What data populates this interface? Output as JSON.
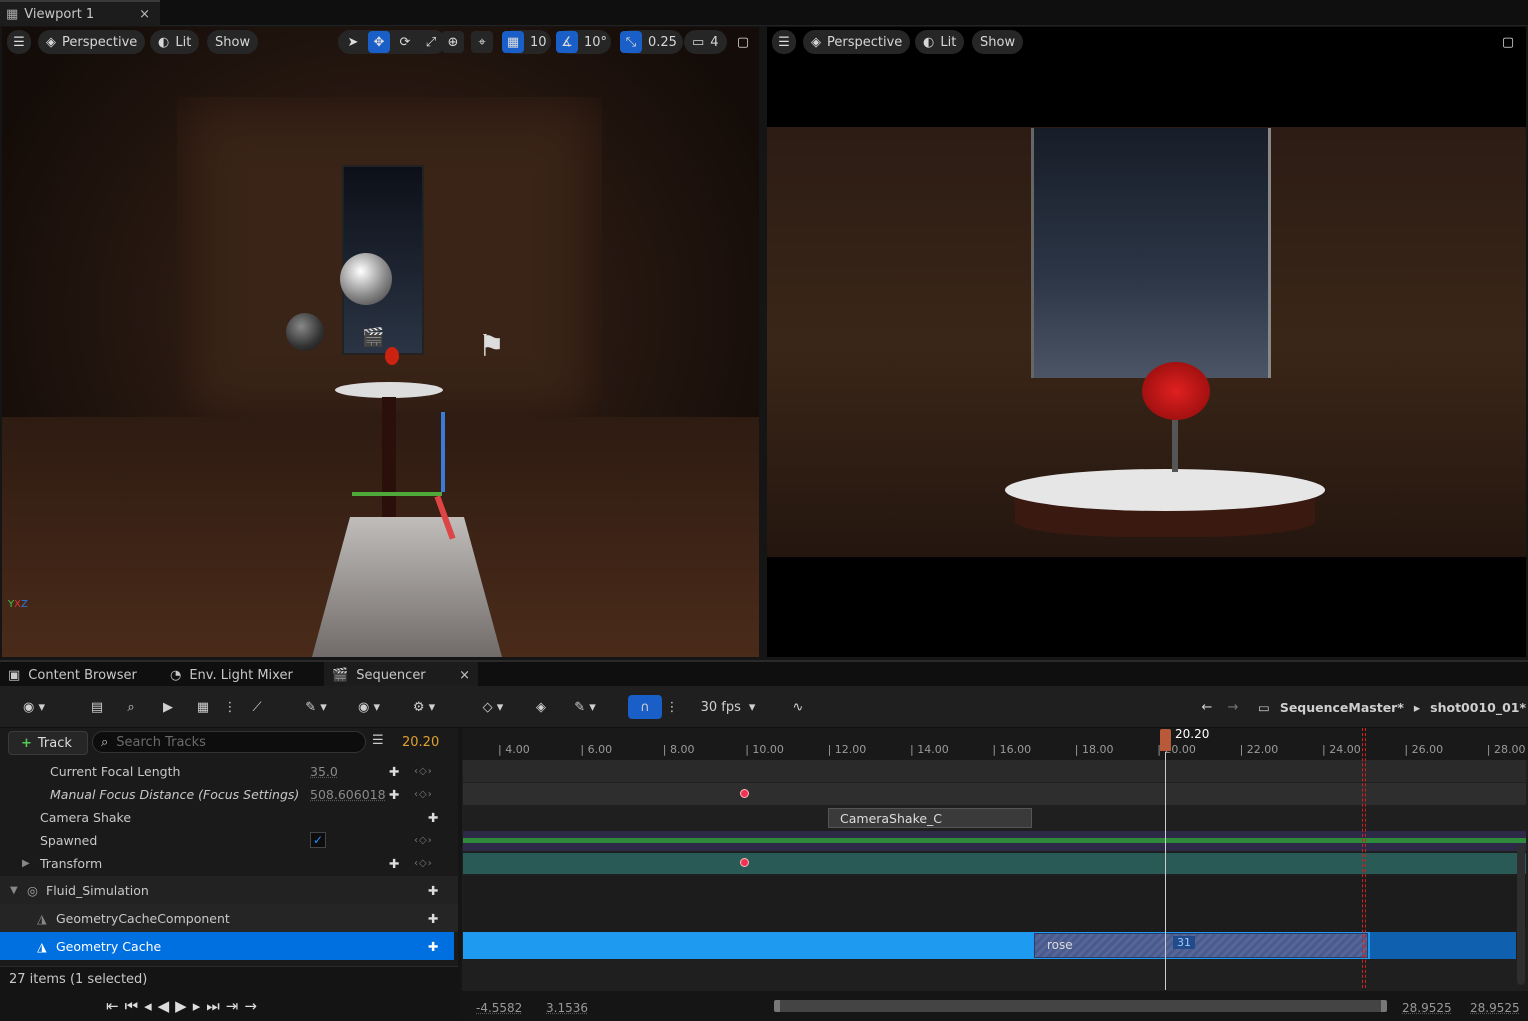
{
  "window": {
    "tab_title": "Viewport 1",
    "close_glyph": "×"
  },
  "viewport1": {
    "menu_icon": "hamburger-icon",
    "view_mode": "Perspective",
    "lighting": "Lit",
    "show": "Show",
    "grid_snap": "10",
    "rot_snap": "10°",
    "scale_snap": "0.25",
    "cam_speed": "4"
  },
  "viewport2": {
    "view_mode": "Perspective",
    "lighting": "Lit",
    "show": "Show"
  },
  "bottom_tabs": {
    "content_browser": "Content Browser",
    "light_mixer": "Env. Light Mixer",
    "sequencer": "Sequencer",
    "close_glyph": "×"
  },
  "sequencer": {
    "fps": "30 fps",
    "breadcrumb_master": "SequenceMaster*",
    "breadcrumb_shot": "shot0010_01*",
    "track_button": "Track",
    "search_placeholder": "Search Tracks",
    "current_time": "20.20",
    "playhead_label": "20.20",
    "status": "27 items (1 selected)"
  },
  "tracks": [
    {
      "label": "Current Focal Length",
      "value": "35.0",
      "indent": 50,
      "italic": false
    },
    {
      "label": "Manual Focus Distance (Focus Settings)",
      "value": "508.606018",
      "indent": 50,
      "italic": true
    },
    {
      "label": "Camera Shake",
      "value": "",
      "indent": 40,
      "italic": false
    },
    {
      "label": "Spawned",
      "value": "",
      "indent": 40,
      "italic": false
    },
    {
      "label": "Transform",
      "value": "",
      "indent": 40,
      "italic": false
    },
    {
      "label": "Fluid_Simulation",
      "value": "",
      "indent": 46,
      "italic": false
    },
    {
      "label": "GeometryCacheComponent",
      "value": "",
      "indent": 56,
      "italic": false
    },
    {
      "label": "Geometry Cache",
      "value": "",
      "indent": 56,
      "italic": false
    }
  ],
  "ruler_ticks": [
    "4.00",
    "6.00",
    "8.00",
    "10.00",
    "12.00",
    "14.00",
    "16.00",
    "18.00",
    "20.00",
    "22.00",
    "24.00",
    "26.00",
    "28.00"
  ],
  "sections": {
    "camera_shake": "CameraShake_C",
    "rose": "rose",
    "frame_badge": "31"
  },
  "timebar": {
    "view_start": "-4.5582",
    "working_start": "3.1536",
    "working_end": "28.9525",
    "view_end": "28.9525"
  },
  "colors": {
    "accent": "#1a5fc8",
    "selected_row": "#0070e0",
    "geo_bar": "#1e9bf0",
    "transform_lane": "#2a5a55"
  }
}
